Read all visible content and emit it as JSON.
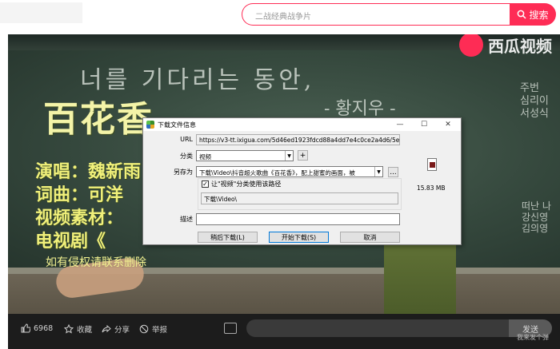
{
  "header": {
    "search_placeholder": "二战经典战争片",
    "search_button": "搜索"
  },
  "video": {
    "watermark": "西瓜视频",
    "chalk_top": "너를 기다리는 동안,",
    "chalk_mid": "- 황지우 -",
    "chalk_right": "주번\n심리이\n서성식",
    "chalk_right2": "떠난 나\n강신영\n김의영\n",
    "song_title": "百花香",
    "credits": [
      "演唱：魏新雨",
      "词曲：可洋",
      "视频素材：",
      "电视剧《"
    ],
    "notice": "如有侵权请联系删除"
  },
  "dialog": {
    "title": "下载文件信息",
    "url_label": "URL",
    "url_value": "https://v3-tt.ixigua.com/5d46ed1923fdcd88a4dd7e4c0ce2a4d6/5e807373",
    "category_label": "分类",
    "category_value": "视频",
    "add_button": "+",
    "saveas_label": "另存为",
    "saveas_value": "下载\\Video\\抖音超火歌曲《百花香》，配上甜蜜的画面，被",
    "browse_button": "...",
    "checkbox_label": "让\"视频\"分类使用该路径",
    "path_value": "下载\\Video\\",
    "desc_label": "描述",
    "desc_value": "",
    "file_size": "15.83 MB",
    "later_button": "稍后下载(L)",
    "start_button": "开始下载(S)",
    "cancel_button": "取消"
  },
  "bottombar": {
    "likes": "6968",
    "collect": "收藏",
    "share": "分享",
    "report": "举报",
    "send_button": "发送",
    "send_tip": "我来发个弹"
  }
}
